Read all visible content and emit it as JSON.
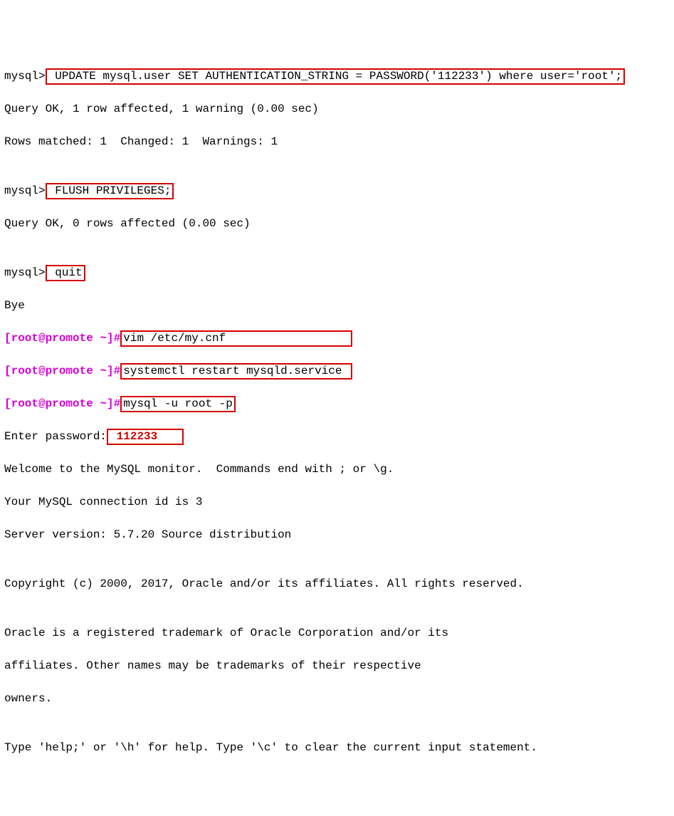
{
  "lines": {
    "l1_prompt": "mysql>",
    "l1_cmd": " UPDATE mysql.user SET AUTHENTICATION_STRING = PASSWORD('112233') where user='root';",
    "l2": "Query OK, 1 row affected, 1 warning (0.00 sec)",
    "l3": "Rows matched: 1  Changed: 1  Warnings: 1",
    "l4": "",
    "l5_prompt": "mysql>",
    "l5_cmd": " FLUSH PRIVILEGES;",
    "l6": "Query OK, 0 rows affected (0.00 sec)",
    "l7": "",
    "l8_prompt": "mysql>",
    "l8_cmd": " quit",
    "l9": "Bye",
    "l10_prompt": "[root@promote ~]#",
    "l10_cmd": "vim /etc/my.cnf",
    "l11_prompt": "[root@promote ~]#",
    "l11_cmd": "systemctl restart mysqld.service",
    "l12_prompt": "[root@promote ~]#",
    "l12_cmd": "mysql -u root -p",
    "l13_label": "Enter password:",
    "l13_pw": " 112233",
    "l14": "Welcome to the MySQL monitor.  Commands end with ; or \\g.",
    "l15": "Your MySQL connection id is 3",
    "l16": "Server version: 5.7.20 Source distribution",
    "l17": "",
    "l18": "Copyright (c) 2000, 2017, Oracle and/or its affiliates. All rights reserved.",
    "l19": "",
    "l20": "Oracle is a registered trademark of Oracle Corporation and/or its",
    "l21": "affiliates. Other names may be trademarks of their respective",
    "l22": "owners.",
    "l23": "",
    "l24": "Type 'help;' or '\\h' for help. Type '\\c' to clear the current input statement."
  }
}
